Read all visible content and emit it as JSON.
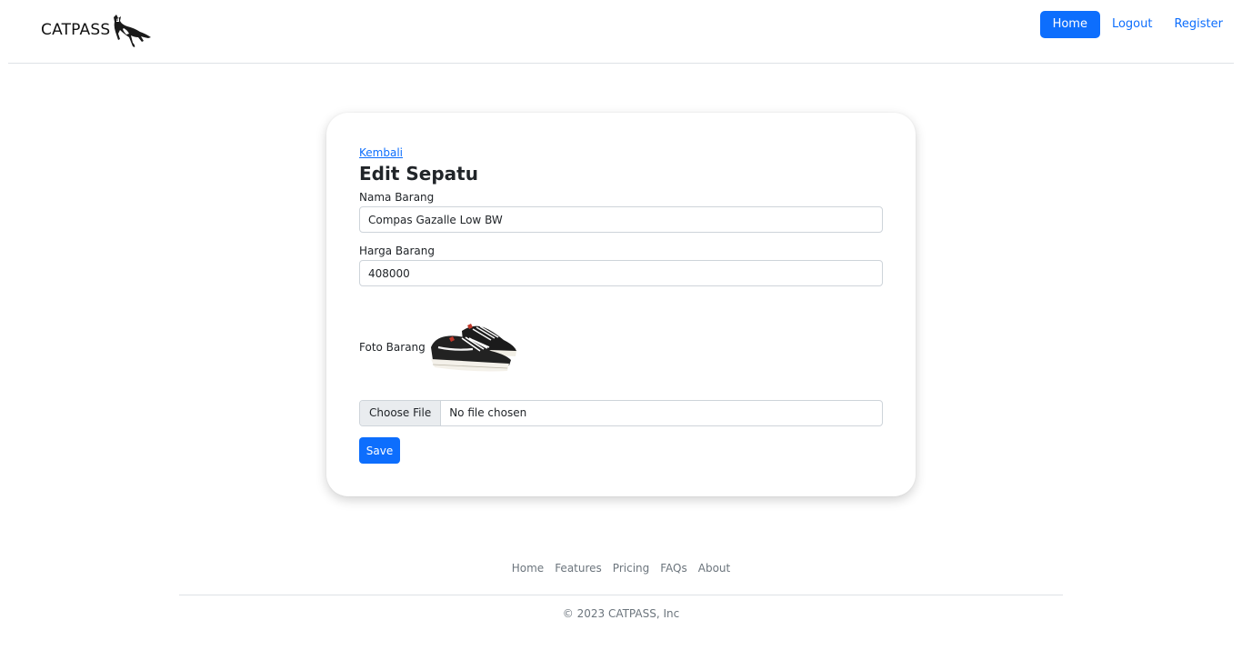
{
  "header": {
    "brand": "CATPASS",
    "nav": [
      {
        "label": "Home",
        "active": true
      },
      {
        "label": "Logout",
        "active": false
      },
      {
        "label": "Register",
        "active": false
      }
    ]
  },
  "form": {
    "back_link": "Kembali",
    "title": "Edit Sepatu",
    "name_label": "Nama Barang",
    "name_value": "Compas Gazalle Low BW",
    "price_label": "Harga Barang",
    "price_value": "408000",
    "photo_label": "Foto Barang",
    "file_button": "Choose File",
    "file_status": "No file chosen",
    "save_label": "Save"
  },
  "footer": {
    "links": [
      "Home",
      "Features",
      "Pricing",
      "FAQs",
      "About"
    ],
    "copyright": "© 2023 CATPASS, Inc"
  },
  "colors": {
    "primary": "#0d6efd",
    "muted": "#6c757d",
    "border": "#dee2e6"
  }
}
